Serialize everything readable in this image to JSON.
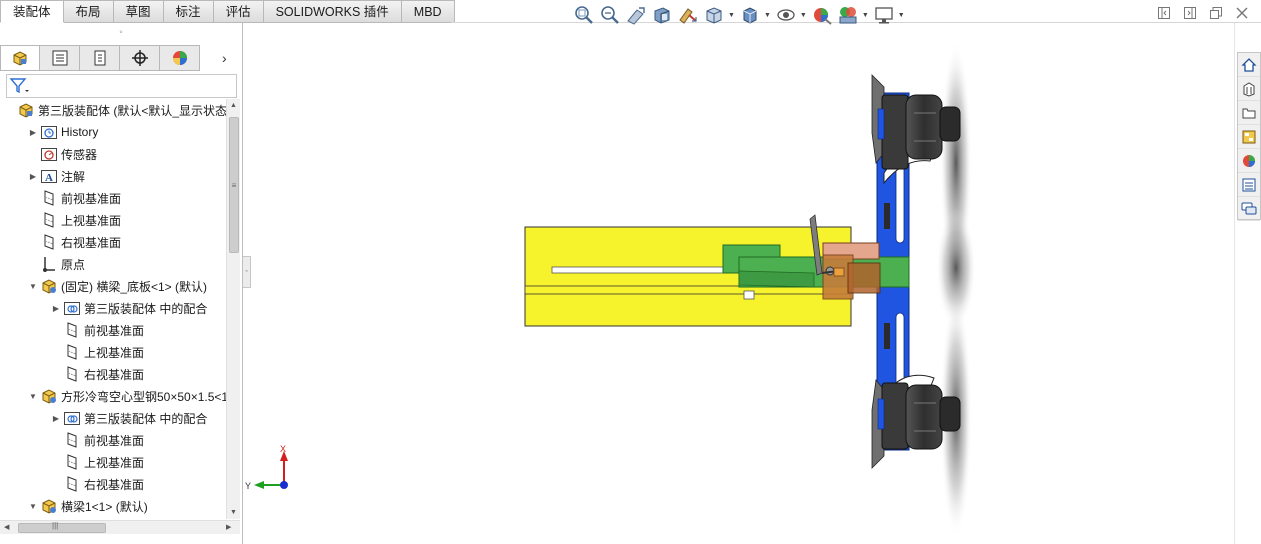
{
  "tabs": [
    "装配体",
    "布局",
    "草图",
    "标注",
    "评估",
    "SOLIDWORKS 插件",
    "MBD"
  ],
  "active_tab": "装配体",
  "hud_icons": [
    "zoom-to-fit-icon",
    "zoom-to-area-icon",
    "previous-view-icon",
    "section-view-icon",
    "dynamic-annotation-icon",
    "view-orientation-icon",
    "display-style-icon",
    "hide-show-items-icon",
    "edit-appearance-icon",
    "apply-scene-icon",
    "view-settings-icon"
  ],
  "panel": {
    "tabs": [
      "featuremanager-tab",
      "propertymanager-tab",
      "configurationmanager-tab",
      "dimxpert-tab",
      "display-manager-tab"
    ],
    "next_arrow": "›",
    "grip": "◦"
  },
  "tree": [
    {
      "label": "第三版装配体  (默认<默认_显示状态-",
      "icon": "assembly-icon",
      "indent": 0,
      "expander": ""
    },
    {
      "label": "History",
      "icon": "history-icon",
      "indent": 1,
      "expander": "▶"
    },
    {
      "label": "传感器",
      "icon": "sensor-icon",
      "indent": 1,
      "expander": ""
    },
    {
      "label": "注解",
      "icon": "annotation-icon",
      "indent": 1,
      "expander": "▶"
    },
    {
      "label": "前视基准面",
      "icon": "plane-icon",
      "indent": 1,
      "expander": ""
    },
    {
      "label": "上视基准面",
      "icon": "plane-icon",
      "indent": 1,
      "expander": ""
    },
    {
      "label": "右视基准面",
      "icon": "plane-icon",
      "indent": 1,
      "expander": ""
    },
    {
      "label": "原点",
      "icon": "origin-icon",
      "indent": 1,
      "expander": ""
    },
    {
      "label": "(固定) 横梁_底板<1> (默认)",
      "icon": "part-icon",
      "indent": 1,
      "expander": "▼"
    },
    {
      "label": "第三版装配体 中的配合",
      "icon": "mates-folder-icon",
      "indent": 2,
      "expander": "▶"
    },
    {
      "label": "前视基准面",
      "icon": "plane-icon",
      "indent": 2,
      "expander": ""
    },
    {
      "label": "上视基准面",
      "icon": "plane-icon",
      "indent": 2,
      "expander": ""
    },
    {
      "label": "右视基准面",
      "icon": "plane-icon",
      "indent": 2,
      "expander": ""
    },
    {
      "label": "方形冷弯空心型钢50×50×1.5<1",
      "icon": "part-icon",
      "indent": 1,
      "expander": "▼"
    },
    {
      "label": "第三版装配体 中的配合",
      "icon": "mates-folder-icon",
      "indent": 2,
      "expander": "▶"
    },
    {
      "label": "前视基准面",
      "icon": "plane-icon",
      "indent": 2,
      "expander": ""
    },
    {
      "label": "上视基准面",
      "icon": "plane-icon",
      "indent": 2,
      "expander": ""
    },
    {
      "label": "右视基准面",
      "icon": "plane-icon",
      "indent": 2,
      "expander": ""
    },
    {
      "label": "横梁1<1> (默认)",
      "icon": "part-icon",
      "indent": 1,
      "expander": "▼"
    }
  ],
  "triad": {
    "x_label": "X",
    "y_label": "Y"
  },
  "task_pane": [
    "solidworks-resources-icon",
    "design-library-icon",
    "file-explorer-icon",
    "view-palette-icon",
    "appearances-icon",
    "custom-properties-icon",
    "forum-icon"
  ],
  "colors": {
    "plate_yellow": "#f6f22c",
    "frame_blue": "#1f55e0",
    "slide_green": "#4caf50",
    "bracket_brown": "#c57d3a",
    "motor_dark": "#3c3c3c",
    "accent_orange": "#e9a23b"
  }
}
